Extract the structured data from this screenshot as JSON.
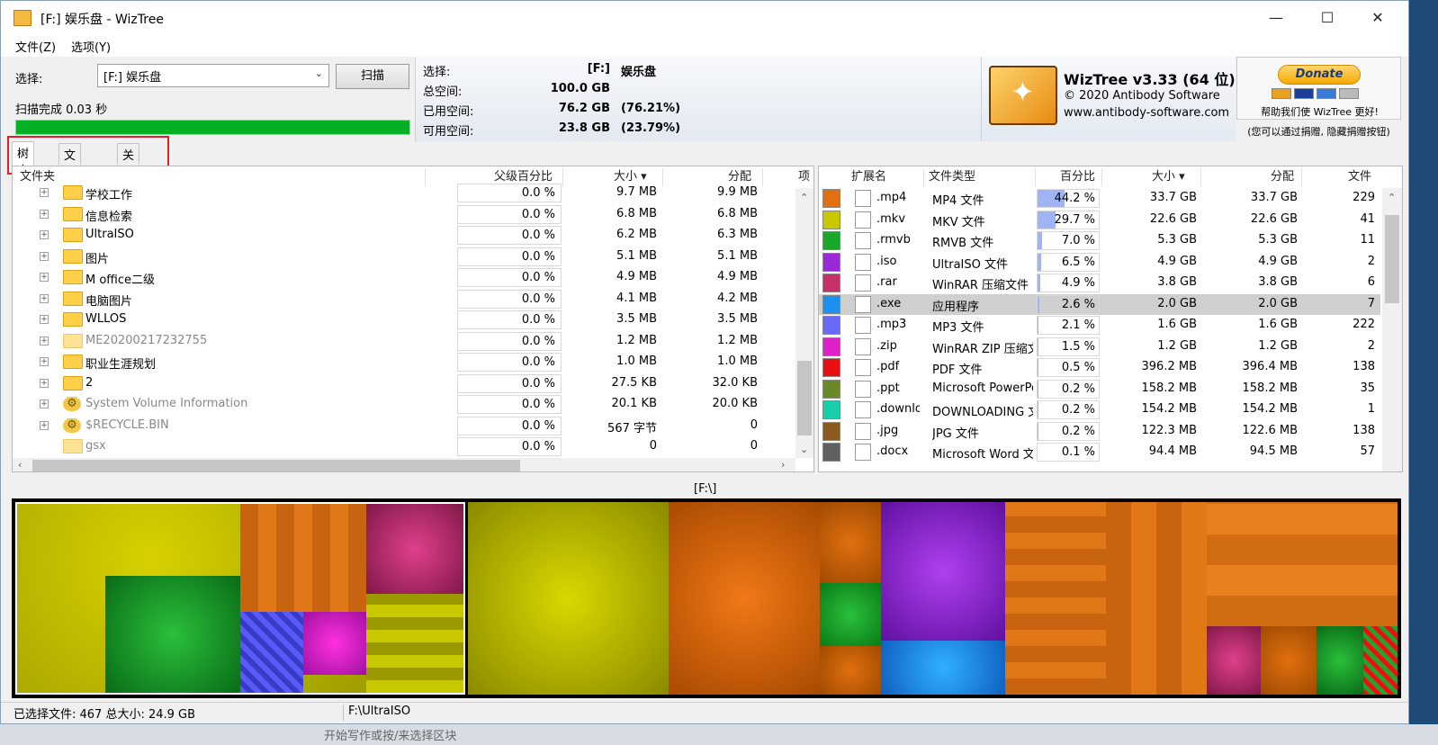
{
  "window": {
    "title": "[F:] 娱乐盘  - WizTree",
    "minimize": "—",
    "maximize": "☐",
    "close": "✕"
  },
  "menu": [
    "文件(Z)",
    "选项(Y)"
  ],
  "scan": {
    "select_label": "选择:",
    "drive_value": "[F:] 娱乐盘",
    "scan_button": "扫描",
    "status": "扫描完成 0.03 秒",
    "progress_percent": 100
  },
  "drive_info": {
    "select_label": "选择:",
    "select_drive": "[F:]",
    "select_name": "娱乐盘",
    "total_label": "总空间:",
    "total_value": "100.0 GB",
    "used_label": "已用空间:",
    "used_value": "76.2 GB",
    "used_pct": "(76.21%)",
    "free_label": "可用空间:",
    "free_value": "23.8 GB",
    "free_pct": "(23.79%)"
  },
  "brand": {
    "title": "WizTree v3.33 (64 位)",
    "copyright": "© 2020 Antibody Software",
    "url": "www.antibody-software.com"
  },
  "donate": {
    "button": "Donate",
    "text": "帮助我们使 WizTree 更好!",
    "note": "(您可以通过捐赠, 隐藏捐赠按钮)"
  },
  "tabs": [
    "树查看",
    "文件查看",
    "关于"
  ],
  "tree": {
    "columns": [
      "文件夹",
      "父级百分比",
      "大小 ▾",
      "分配",
      "项"
    ],
    "rows": [
      {
        "name": "学校工作",
        "pct": "0.0 %",
        "size": "9.7 MB",
        "alloc": "9.9 MB",
        "grey": false
      },
      {
        "name": "信息检索",
        "pct": "0.0 %",
        "size": "6.8 MB",
        "alloc": "6.8 MB",
        "grey": false
      },
      {
        "name": "UltraISO",
        "pct": "0.0 %",
        "size": "6.2 MB",
        "alloc": "6.3 MB",
        "grey": false
      },
      {
        "name": "图片",
        "pct": "0.0 %",
        "size": "5.1 MB",
        "alloc": "5.1 MB",
        "grey": false
      },
      {
        "name": "M office二级",
        "pct": "0.0 %",
        "size": "4.9 MB",
        "alloc": "4.9 MB",
        "grey": false
      },
      {
        "name": "电脑图片",
        "pct": "0.0 %",
        "size": "4.1 MB",
        "alloc": "4.2 MB",
        "grey": false
      },
      {
        "name": "WLLOS",
        "pct": "0.0 %",
        "size": "3.5 MB",
        "alloc": "3.5 MB",
        "grey": false
      },
      {
        "name": "ME20200217232755",
        "pct": "0.0 %",
        "size": "1.2 MB",
        "alloc": "1.2 MB",
        "grey": true
      },
      {
        "name": "职业生涯规划",
        "pct": "0.0 %",
        "size": "1.0 MB",
        "alloc": "1.0 MB",
        "grey": false
      },
      {
        "name": "2",
        "pct": "0.0 %",
        "size": "27.5 KB",
        "alloc": "32.0 KB",
        "grey": false
      },
      {
        "name": "System Volume Information",
        "pct": "0.0 %",
        "size": "20.1 KB",
        "alloc": "20.0 KB",
        "grey": true
      },
      {
        "name": "$RECYCLE.BIN",
        "pct": "0.0 %",
        "size": "567 字节",
        "alloc": "0",
        "grey": true
      },
      {
        "name": "gsx",
        "pct": "0.0 %",
        "size": "0",
        "alloc": "0",
        "grey": true
      }
    ]
  },
  "ext": {
    "columns": [
      "扩展名",
      "文件类型",
      "百分比",
      "大小 ▾",
      "分配",
      "文件"
    ],
    "rows": [
      {
        "ext": ".mp4",
        "type": "MP4 文件",
        "pct": "44.2 %",
        "pct_value": 44.2,
        "size": "33.7 GB",
        "alloc": "33.7 GB",
        "files": "229",
        "color": "#e07010"
      },
      {
        "ext": ".mkv",
        "type": "MKV 文件",
        "pct": "29.7 %",
        "pct_value": 29.7,
        "size": "22.6 GB",
        "alloc": "22.6 GB",
        "files": "41",
        "color": "#c8c800"
      },
      {
        "ext": ".rmvb",
        "type": "RMVB 文件",
        "pct": "7.0 %",
        "pct_value": 7.0,
        "size": "5.3 GB",
        "alloc": "5.3 GB",
        "files": "11",
        "color": "#1aa82a"
      },
      {
        "ext": ".iso",
        "type": "UltraISO 文件",
        "pct": "6.5 %",
        "pct_value": 6.5,
        "size": "4.9 GB",
        "alloc": "4.9 GB",
        "files": "2",
        "color": "#9a2ad8"
      },
      {
        "ext": ".rar",
        "type": "WinRAR 压缩文件",
        "pct": "4.9 %",
        "pct_value": 4.9,
        "size": "3.8 GB",
        "alloc": "3.8 GB",
        "files": "6",
        "color": "#c8306a"
      },
      {
        "ext": ".exe",
        "type": "应用程序",
        "pct": "2.6 %",
        "pct_value": 2.6,
        "size": "2.0 GB",
        "alloc": "2.0 GB",
        "files": "7",
        "color": "#1a90f0"
      },
      {
        "ext": ".mp3",
        "type": "MP3 文件",
        "pct": "2.1 %",
        "pct_value": 2.1,
        "size": "1.6 GB",
        "alloc": "1.6 GB",
        "files": "222",
        "color": "#6a6af8"
      },
      {
        "ext": ".zip",
        "type": "WinRAR ZIP 压缩文",
        "pct": "1.5 %",
        "pct_value": 1.5,
        "size": "1.2 GB",
        "alloc": "1.2 GB",
        "files": "2",
        "color": "#e020c8"
      },
      {
        "ext": ".pdf",
        "type": "PDF 文件",
        "pct": "0.5 %",
        "pct_value": 0.5,
        "size": "396.2 MB",
        "alloc": "396.4 MB",
        "files": "138",
        "color": "#e81010"
      },
      {
        "ext": ".ppt",
        "type": "Microsoft PowerPo",
        "pct": "0.2 %",
        "pct_value": 0.2,
        "size": "158.2 MB",
        "alloc": "158.2 MB",
        "files": "35",
        "color": "#6a8a28"
      },
      {
        "ext": ".downlo",
        "type": "DOWNLOADING 文",
        "pct": "0.2 %",
        "pct_value": 0.2,
        "size": "154.2 MB",
        "alloc": "154.2 MB",
        "files": "1",
        "color": "#18d0a8"
      },
      {
        "ext": ".jpg",
        "type": "JPG 文件",
        "pct": "0.2 %",
        "pct_value": 0.2,
        "size": "122.3 MB",
        "alloc": "122.6 MB",
        "files": "138",
        "color": "#8a5a20"
      },
      {
        "ext": ".docx",
        "type": "Microsoft Word 文",
        "pct": "0.1 %",
        "pct_value": 0.1,
        "size": "94.4 MB",
        "alloc": "94.5 MB",
        "files": "57",
        "color": "#606060"
      }
    ]
  },
  "treemap": {
    "path": "[F:\\]"
  },
  "status": {
    "left": "已选择文件: 467  总大小: 24.9 GB",
    "right": "F:\\UltraISO"
  },
  "background_text": "开始写作或按/来选择区块"
}
